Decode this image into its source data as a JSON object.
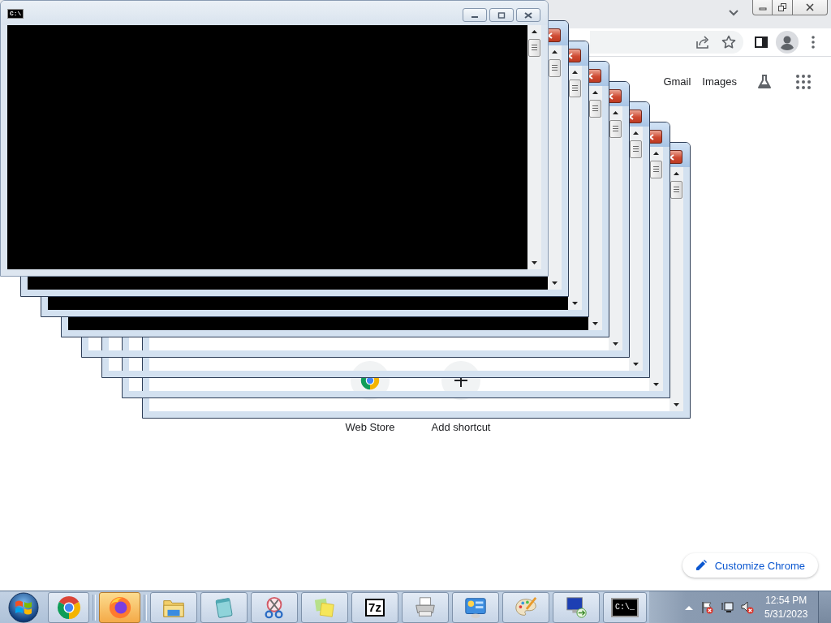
{
  "browser": {
    "top_links": [
      "Gmail",
      "Images"
    ],
    "shortcuts": [
      {
        "kind": "chrome",
        "label": "Web Store"
      },
      {
        "kind": "add",
        "label": "Add shortcut"
      }
    ],
    "customize_button": "Customize Chrome"
  },
  "console_windows": [
    {
      "title_icon": "C:\\",
      "active": false,
      "kind": "console",
      "caption_buttons": [
        {
          "kind": "minimize"
        },
        {
          "kind": "maximize"
        },
        {
          "kind": "close"
        }
      ]
    },
    {
      "active": true,
      "kind": "console",
      "caption_buttons": [
        {
          "kind": "close"
        }
      ]
    },
    {
      "active": true,
      "kind": "console",
      "caption_buttons": [
        {
          "kind": "close"
        }
      ]
    },
    {
      "active": true,
      "kind": "console",
      "caption_buttons": [
        {
          "kind": "close"
        }
      ]
    },
    {
      "active": true,
      "kind": "blank",
      "caption_buttons": [
        {
          "kind": "close"
        }
      ]
    },
    {
      "active": true,
      "kind": "blank",
      "caption_buttons": [
        {
          "kind": "close"
        }
      ]
    },
    {
      "active": true,
      "kind": "blank",
      "caption_buttons": [
        {
          "kind": "close"
        }
      ]
    },
    {
      "active": true,
      "kind": "blank",
      "caption_buttons": [
        {
          "kind": "close"
        }
      ]
    }
  ],
  "taskbar": {
    "buttons": [
      {
        "kind": "chrome",
        "flashing": false
      },
      {
        "kind": "firefox",
        "flashing": true
      },
      {
        "kind": "explorer",
        "flashing": false
      },
      {
        "kind": "notepad",
        "flashing": false
      },
      {
        "kind": "snipping",
        "flashing": false
      },
      {
        "kind": "stickynotes",
        "flashing": false
      },
      {
        "kind": "archive",
        "label": "7z",
        "flashing": false
      },
      {
        "kind": "printer",
        "flashing": false
      },
      {
        "kind": "controlpanel",
        "flashing": false
      },
      {
        "kind": "paint",
        "flashing": false
      },
      {
        "kind": "remotedesktop",
        "flashing": false
      },
      {
        "kind": "console",
        "label": "C:\\_",
        "flashing": false
      }
    ],
    "tray": [
      {
        "kind": "actioncenter",
        "alert": true
      },
      {
        "kind": "network",
        "alert": false
      },
      {
        "kind": "volume",
        "alert": true
      }
    ],
    "clock": {
      "time": "12:54 PM",
      "date": "5/31/2023"
    }
  }
}
